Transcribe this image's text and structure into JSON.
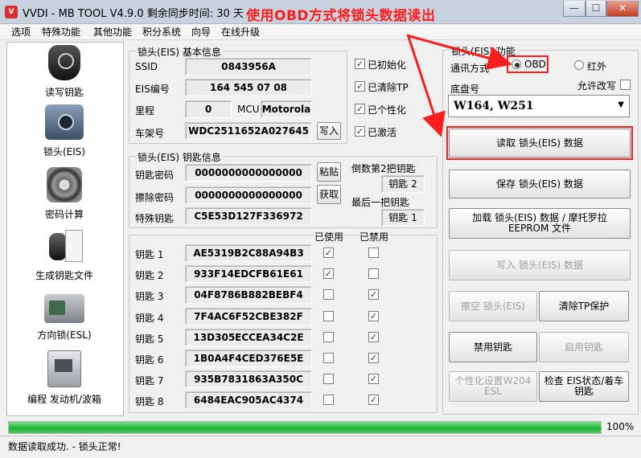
{
  "window": {
    "title": "VVDI - MB TOOL V4.9.0   剩余同步时间: 30 天",
    "annotation": "使用OBD方式将锁头数据读出",
    "minimize_label": "—",
    "maximize_label": "☐",
    "close_label": "✕"
  },
  "menu": [
    "选项",
    "特殊功能",
    "其他功能",
    "积分系统",
    "向导",
    "在线升级"
  ],
  "sidebar": [
    {
      "label": "读写钥匙",
      "icon": "car-key-icon"
    },
    {
      "label": "锁头(EIS)",
      "icon": "eis-lock-icon"
    },
    {
      "label": "密码计算",
      "icon": "gear-calc-icon"
    },
    {
      "label": "生成钥匙文件",
      "icon": "key-file-icon"
    },
    {
      "label": "方向锁(ESL)",
      "icon": "steering-lock-icon"
    },
    {
      "label": "编程 发动机/波箱",
      "icon": "ecu-icon"
    }
  ],
  "basic_info": {
    "title": "锁头(EIS) 基本信息",
    "ssid_label": "SSID",
    "ssid": "0843956A",
    "eis_label": "EIS编号",
    "eis": "164 545 07 08",
    "mileage_label": "里程",
    "mileage": "0",
    "mcu_label": "MCU",
    "mcu": "Motorola",
    "vin_label": "车架号",
    "vin": "WDC2511652A027645",
    "write_label": "写入",
    "checks": [
      "已初始化",
      "已清除TP",
      "已个性化",
      "已激活"
    ]
  },
  "key_info": {
    "title": "锁头(EIS) 钥匙信息",
    "key_pw_label": "钥匙密码",
    "key_pw": "0000000000000000",
    "erase_pw_label": "擦除密码",
    "erase_pw": "0000000000000000",
    "special_label": "特殊钥匙",
    "special": "C5E53D127F336972",
    "paste_label": "粘贴",
    "get_label": "获取",
    "second_last_label": "倒数第2把钥匙",
    "second_last": "钥匙 2",
    "last_label": "最后一把钥匙",
    "last": "钥匙 1"
  },
  "keys_table": {
    "used_header": "已使用",
    "disabled_header": "已禁用",
    "rows": [
      {
        "label": "钥匙 1",
        "value": "AE5319B2C88A94B3",
        "used": true,
        "disabled": false
      },
      {
        "label": "钥匙 2",
        "value": "933F14EDCFB61E61",
        "used": true,
        "disabled": false
      },
      {
        "label": "钥匙 3",
        "value": "04F8786B882BEBF4",
        "used": false,
        "disabled": true
      },
      {
        "label": "钥匙 4",
        "value": "7F4AC6F52CBE382F",
        "used": false,
        "disabled": true
      },
      {
        "label": "钥匙 5",
        "value": "13D305ECCEA34C2E",
        "used": false,
        "disabled": true
      },
      {
        "label": "钥匙 6",
        "value": "1B0A4F4CED376E5E",
        "used": false,
        "disabled": true
      },
      {
        "label": "钥匙 7",
        "value": "935B7831863A350C",
        "used": false,
        "disabled": true
      },
      {
        "label": "钥匙 8",
        "value": "6484EAC905AC4374",
        "used": false,
        "disabled": true
      }
    ]
  },
  "function_panel": {
    "title": "锁头(EIS) 功能",
    "comm_label": "通讯方式",
    "obd_label": "OBD",
    "ir_label": "红外",
    "chassis_label": "底盘号",
    "allow_modify_label": "允许改写",
    "chassis_value": "W164, W251",
    "read_btn": "读取 锁头(EIS) 数据",
    "save_btn": "保存 锁头(EIS) 数据",
    "load_btn": "加载 锁头(EIS) 数据 / 摩托罗拉EEPROM 文件",
    "write_btn": "写入 锁头(EIS) 数据",
    "erase_btn": "擦空 锁头(EIS)",
    "clear_tp_btn": "清除TP保护",
    "disable_key_btn": "禁用钥匙",
    "enable_key_btn": "启用钥匙",
    "personalize_btn": "个性化设置W204 ESL",
    "check_eis_btn": "检查 EIS状态/着车钥匙"
  },
  "progress": {
    "value": 100,
    "label": "100%"
  },
  "status": "数据读取成功. - 锁头正常!",
  "colors": {
    "accent_red": "#ff1d1d",
    "progress_green": "#1fb23a"
  }
}
